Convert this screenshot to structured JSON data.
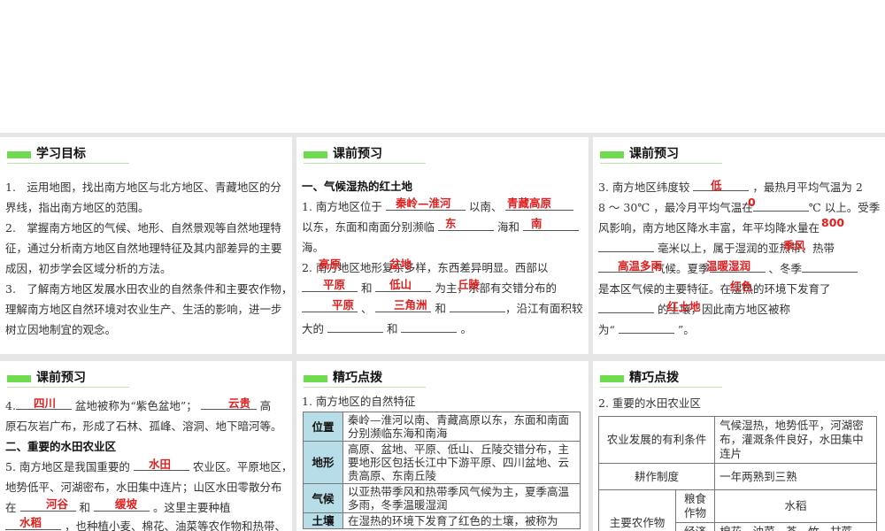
{
  "p1": {
    "title": "学习目标",
    "lines": [
      "1.　运用地图，找出南方地区与北方地区、青藏地区的分",
      "界线，指出南方地区的范围。",
      "2.　掌握南方地区的气候、地形、自然景观等自然地理特",
      "征，通过分析南方地区自然地理特征及其内部差异的主要",
      "成因，初步学会区域分析的方法。",
      "3.　了解南方地区发展水田农业的自然条件和主要农作物，",
      "理解南方地区自然环境对农业生产、生活的影响，进一步",
      "树立因地制宜的观念。"
    ]
  },
  "p2": {
    "title": "课前预习",
    "heading": "一、气候湿热的红土地",
    "t": [
      "1. 南方地区位于",
      "以南、",
      "以东，东面和南面分别濒临",
      "海和",
      "海。",
      "2. 南方地区地形复杂多样，东西差异明显。西部以",
      "和",
      "为主，东部有交错分布的",
      "、",
      "和",
      "，沿江有面积较",
      "大的",
      "和",
      "。"
    ],
    "answers": [
      "秦岭—淮河",
      "青藏高原",
      "东",
      "南",
      "高原",
      "盆地",
      "平原",
      "低山",
      "丘陵",
      "平原",
      "三角洲"
    ]
  },
  "p3": {
    "title": "课前预习",
    "t": [
      "3. 南方地区纬度较",
      "，最热月平均气温为 2",
      "8 ～ 30℃ ，最冷月平均气温在",
      "℃ 以上。受季",
      "风影响，南方地区降水丰富，年平均降水量在",
      "毫米以上，属于湿润的亚热带、热带",
      "气候。夏季",
      "、冬季",
      "是本区气候的主要特征。在湿热的环境下发育了",
      "的土壤，因此南方地区被称",
      "为“",
      "”。"
    ],
    "answers": [
      "低",
      "0",
      "800",
      "季风",
      "高温多雨",
      "温暖湿润",
      "红色",
      "红土地"
    ]
  },
  "p4": {
    "title": "课前预习",
    "t": [
      "4.",
      "盆地被称为“紫色盆地”；",
      "高",
      "原石灰岩广布，形成了石林、孤峰、溶洞、地下暗河等。",
      "二、重要的水田农业区",
      "5. 南方地区是我国重要的",
      "农业区。平原地区，",
      "地势低平、河湖密布，水田集中连片；山区水田零散分布",
      "在",
      "和",
      "。这里主要种植",
      "，也种植小麦、棉花、油菜等农作物和热带、"
    ],
    "answers": [
      "四川",
      "云贵",
      "水田",
      "河谷",
      "缓坡",
      "水稻"
    ]
  },
  "p5": {
    "title": "精巧点拨",
    "sub": "1. 南方地区的自然特征",
    "rows": [
      {
        "k": "位置",
        "v": "秦岭—淮河以南、青藏高原以东，东面和南面分别濒临东海和南海"
      },
      {
        "k": "地形",
        "v": "高原、盆地、平原、低山、丘陵交错分布，主要地形区包括长江中下游平原、四川盆地、云贵高原、东南丘陵"
      },
      {
        "k": "气候",
        "v": "以亚热带季风和热带季风气候为主，夏季高温多雨，冬季温暖湿润"
      },
      {
        "k": "土壤",
        "v": "在湿热的环境下发育了红色的土壤，被称为"
      }
    ]
  },
  "p6": {
    "title": "精巧点拨",
    "sub": "2. 重要的水田农业区",
    "r1k": "农业发展的有利条件",
    "r1v": "气候湿热，地势低平，河湖密布，灌溉条件良好，水田集中连片",
    "r2k": "耕作制度",
    "r2v": "一年两熟到三熟",
    "r3k": "主要农作物",
    "r3a": "粮食作物",
    "r3av": "水稻",
    "r3b": "经济作物",
    "r3bv": "棉花、油菜、茶、竹、甘蔗、橡胶等"
  },
  "colors": {
    "accent": "#6fdb4e",
    "answer": "#e02020",
    "tablehead": "#b7dde8"
  }
}
